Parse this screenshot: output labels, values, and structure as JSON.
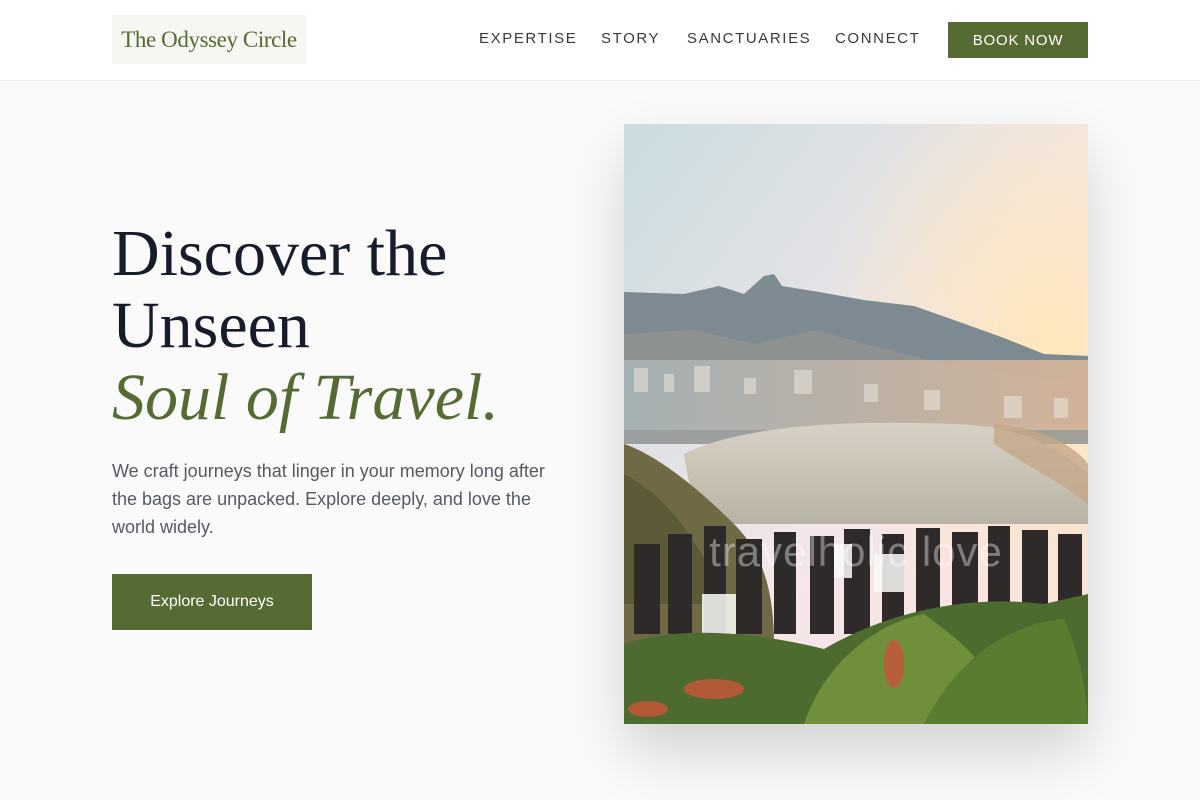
{
  "brand": {
    "name": "The Odyssey Circle"
  },
  "nav": {
    "items": [
      {
        "label": "EXPERTISE"
      },
      {
        "label": "STORY"
      },
      {
        "label": "SANCTUARIES"
      },
      {
        "label": "CONNECT"
      }
    ],
    "cta_label": "BOOK NOW"
  },
  "hero": {
    "headline_line1": "Discover the",
    "headline_line2": "Unseen",
    "headline_accent": "Soul of Travel.",
    "tagline": "We craft journeys that linger in your memory long after the bags are unpacked. Explore deeply, and love the world widely.",
    "cta_label": "Explore Journeys",
    "image_watermark": "travelholic love"
  },
  "colors": {
    "accent": "#566b33",
    "headline": "#171c2b",
    "body_text": "#555a62",
    "page_bg": "#fafafa",
    "header_bg": "#ffffff"
  }
}
